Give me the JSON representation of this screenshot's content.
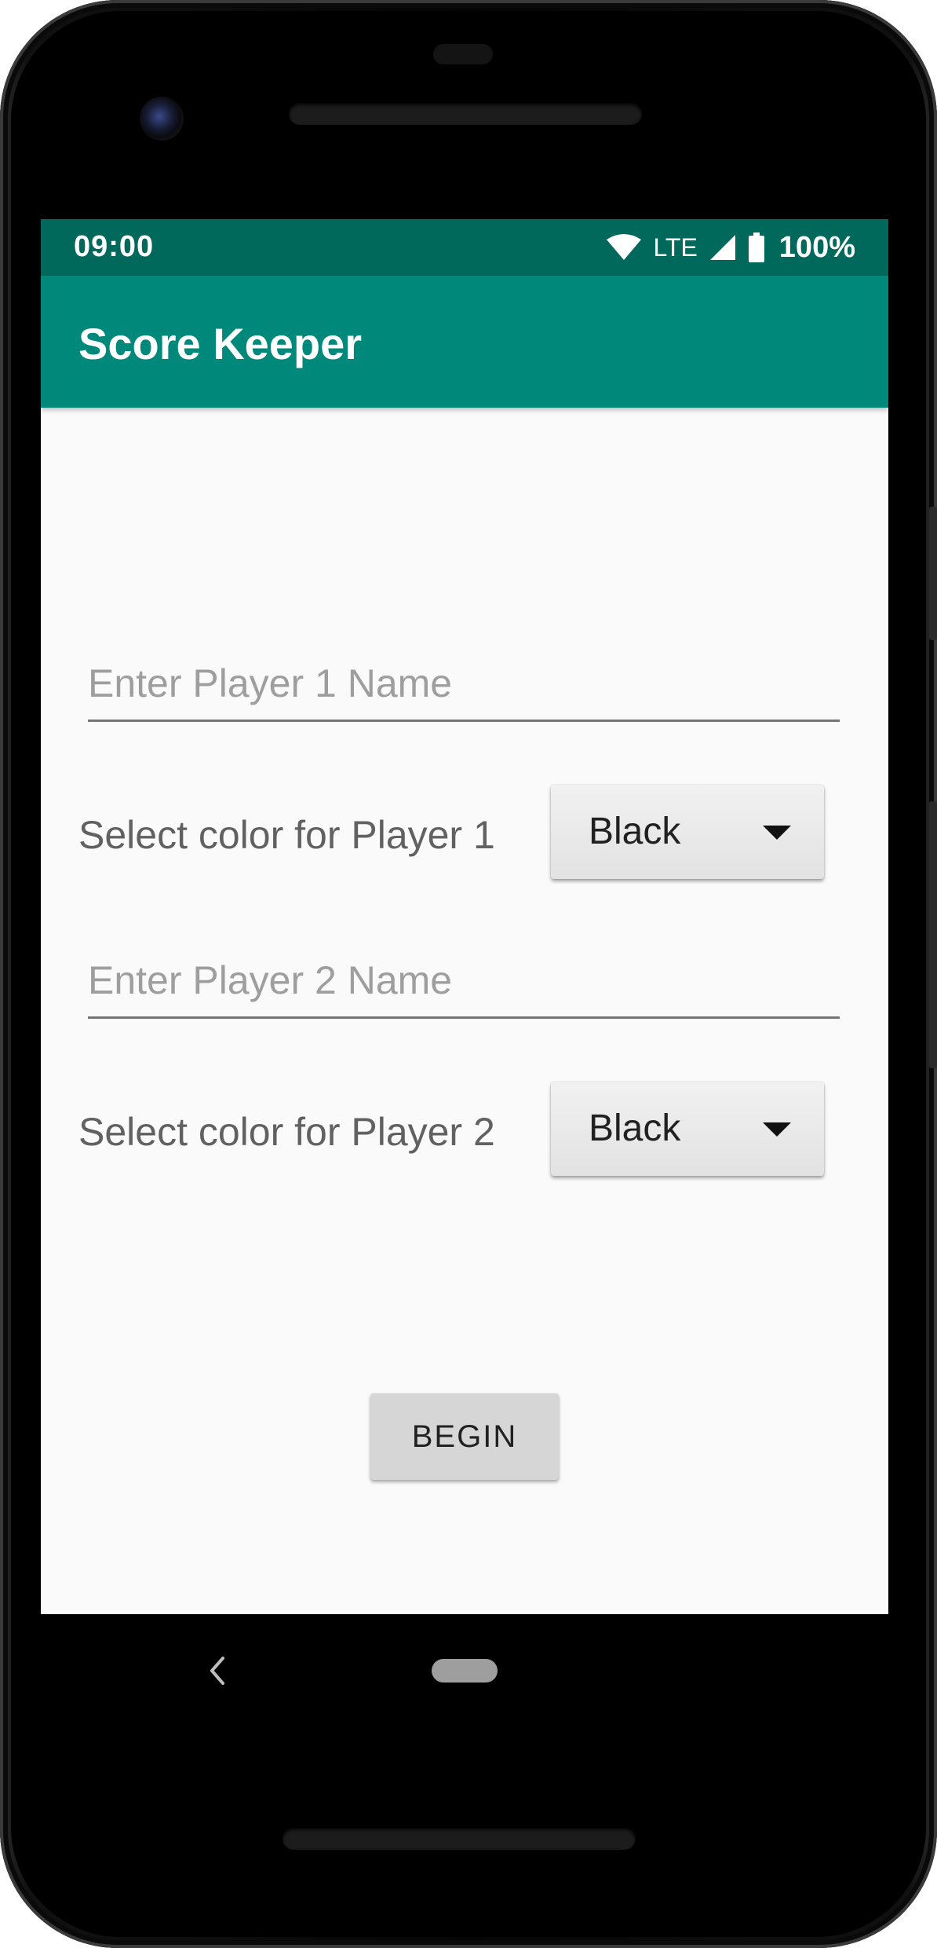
{
  "status_bar": {
    "time": "09:00",
    "network": "LTE",
    "battery": "100%"
  },
  "app_bar": {
    "title": "Score Keeper"
  },
  "form": {
    "player1_name": {
      "value": "",
      "placeholder": "Enter Player 1 Name"
    },
    "player1_color": {
      "label": "Select color for Player 1",
      "selected": "Black"
    },
    "player2_name": {
      "value": "",
      "placeholder": "Enter Player 2 Name"
    },
    "player2_color": {
      "label": "Select color for Player 2",
      "selected": "Black"
    },
    "begin_label": "BEGIN"
  },
  "colors": {
    "status_bar": "#00695c",
    "app_bar": "#00897b",
    "background": "#fafafa"
  },
  "icons": {
    "status": [
      "wifi-icon",
      "cell-signal-icon",
      "battery-icon"
    ],
    "navigation": [
      "back-icon",
      "home-icon"
    ],
    "spinner": "dropdown-arrow-icon"
  }
}
